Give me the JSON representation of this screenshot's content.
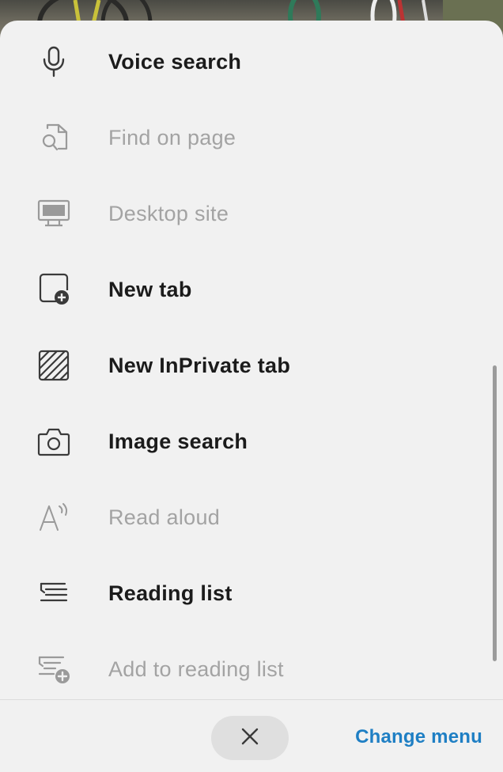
{
  "menu": {
    "items": [
      {
        "label": "Voice search",
        "icon": "microphone-icon",
        "enabled": true
      },
      {
        "label": "Find on page",
        "icon": "find-on-page-icon",
        "enabled": false
      },
      {
        "label": "Desktop site",
        "icon": "desktop-monitor-icon",
        "enabled": false
      },
      {
        "label": "New tab",
        "icon": "new-tab-icon",
        "enabled": true
      },
      {
        "label": "New InPrivate tab",
        "icon": "inprivate-tab-icon",
        "enabled": true
      },
      {
        "label": "Image search",
        "icon": "camera-icon",
        "enabled": true
      },
      {
        "label": "Read aloud",
        "icon": "read-aloud-icon",
        "enabled": false
      },
      {
        "label": "Reading list",
        "icon": "reading-list-icon",
        "enabled": true
      },
      {
        "label": "Add to reading list",
        "icon": "add-to-reading-list-icon",
        "enabled": false
      }
    ]
  },
  "footer": {
    "close_icon": "close-icon",
    "change_menu_label": "Change menu"
  },
  "colors": {
    "accent": "#1f7fc4",
    "sheet_background": "#f1f1f1",
    "enabled_text": "#1b1b1b",
    "disabled_text": "#a3a3a3"
  }
}
